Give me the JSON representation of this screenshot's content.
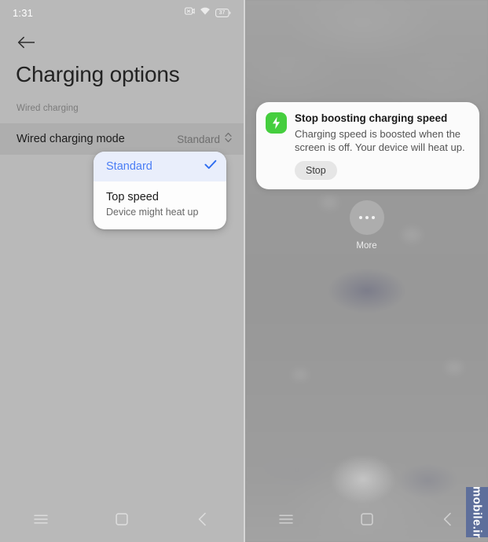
{
  "left_screen": {
    "statusbar": {
      "time": "1:31",
      "icons": [
        "camera-blocked-icon",
        "wifi-icon",
        "battery-icon"
      ],
      "battery_level": "37"
    },
    "back_icon": "back-arrow-icon",
    "title": "Charging options",
    "section_label": "Wired charging",
    "preference": {
      "title": "Wired charging mode",
      "value": "Standard",
      "chevron_icon": "chevron-updown-icon"
    },
    "dropdown": {
      "options": [
        {
          "label": "Standard",
          "subtitle": "",
          "selected": true,
          "check_icon": "check-icon"
        },
        {
          "label": "Top speed",
          "subtitle": "Device might heat up",
          "selected": false
        }
      ]
    },
    "navbar": {
      "items": [
        {
          "icon": "menu-icon",
          "name": "recents-button"
        },
        {
          "icon": "square-icon",
          "name": "home-button"
        },
        {
          "icon": "chevron-left-icon",
          "name": "back-button"
        }
      ]
    }
  },
  "right_screen": {
    "notification": {
      "icon": "charging-bolt-icon",
      "title": "Stop boosting charging speed",
      "body": "Charging speed is boosted when the screen is off. Your device will heat up.",
      "action_label": "Stop"
    },
    "more_tile": {
      "icon": "more-dots-icon",
      "label": "More"
    },
    "navbar": {
      "items": [
        {
          "icon": "menu-icon",
          "name": "recents-button"
        },
        {
          "icon": "square-icon",
          "name": "home-button"
        },
        {
          "icon": "chevron-left-icon",
          "name": "back-button"
        }
      ]
    },
    "watermark": "mobile.ir"
  },
  "colors": {
    "left_bg": "#b9b9b9",
    "right_bg": "#9a9a9a",
    "row_highlight": "#aeaeae",
    "accent_blue": "#4a7df5",
    "dropdown_selected_bg": "#e9eefb",
    "notification_icon_green": "#45ce3e",
    "watermark_blue": "#5e6f9b"
  }
}
